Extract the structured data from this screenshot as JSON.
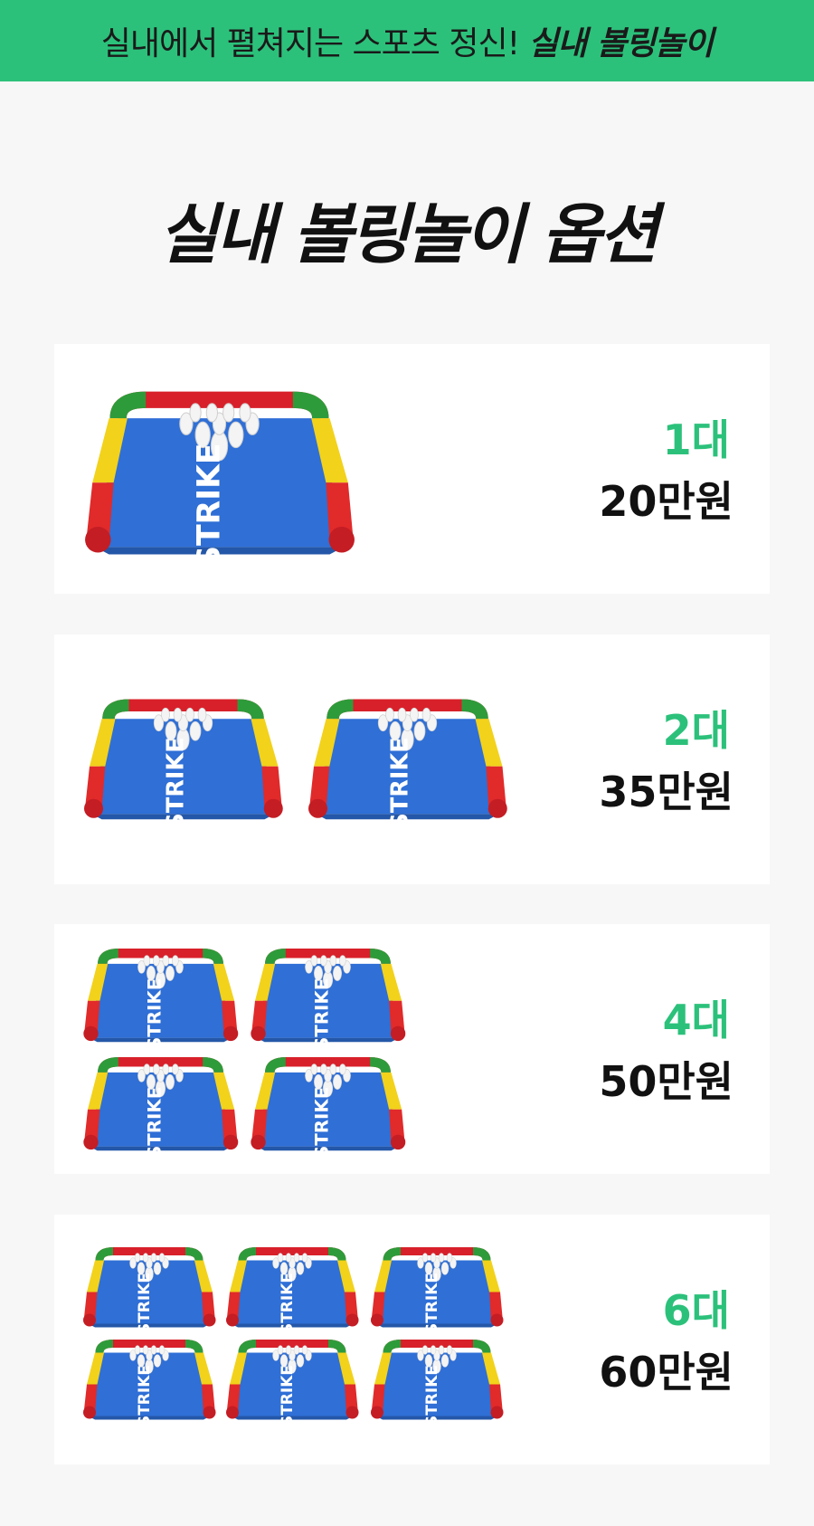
{
  "banner": {
    "text": "실내에서 펼쳐지는 스포츠 정신!",
    "highlight": "실내 볼링놀이"
  },
  "page_title": "실내 볼링놀이 옵션",
  "options": [
    {
      "qty": "1대",
      "price": "20만원",
      "image": "inflatable-bowling-lane-icon"
    },
    {
      "qty": "2대",
      "price": "35만원",
      "image": "inflatable-bowling-lane-icon"
    },
    {
      "qty": "4대",
      "price": "50만원",
      "image": "inflatable-bowling-lane-icon"
    },
    {
      "qty": "6대",
      "price": "60만원",
      "image": "inflatable-bowling-lane-icon"
    }
  ],
  "lane_text": "STRIKE",
  "colors": {
    "accent": "#2cc17b",
    "background": "#f7f7f7",
    "card": "#ffffff"
  }
}
